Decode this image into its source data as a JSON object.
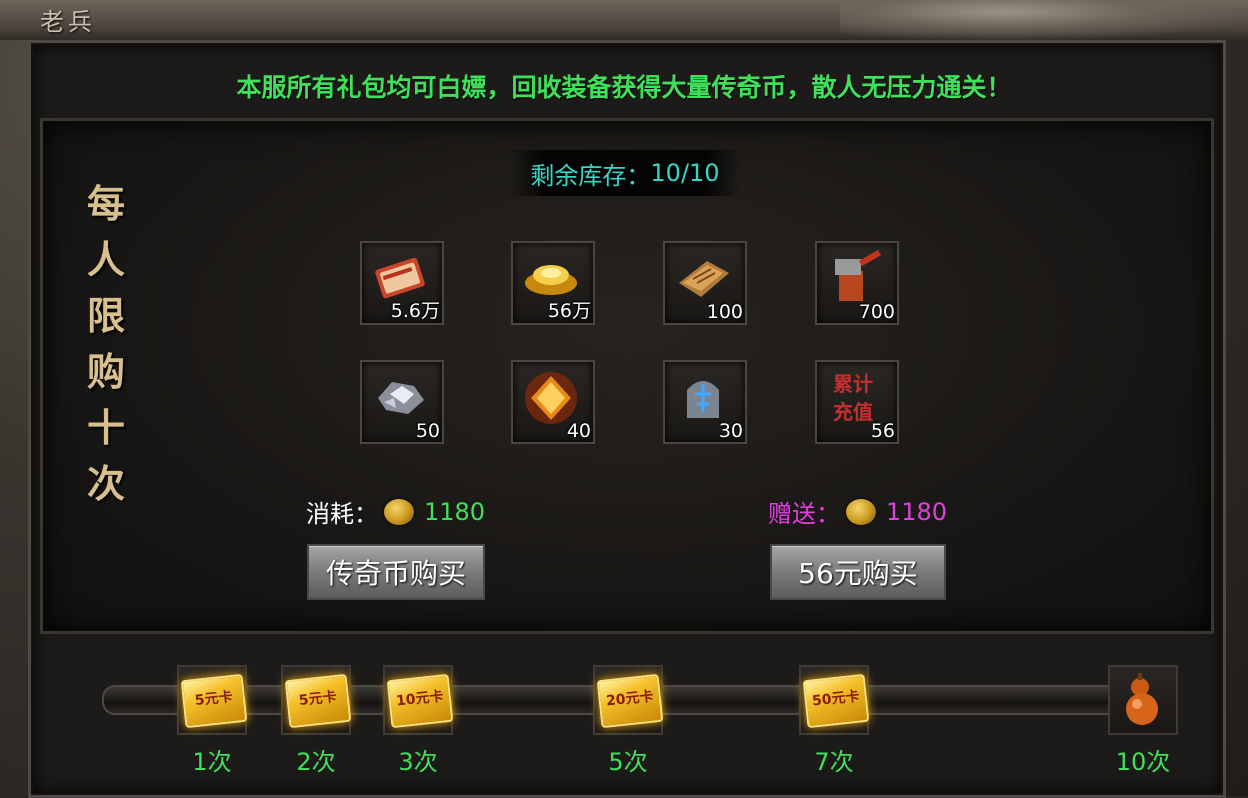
{
  "window": {
    "title": "老兵"
  },
  "banner": "本服所有礼包均可白嫖，回收装备获得大量传奇币，散人无压力通关！",
  "vertical_title": [
    "每",
    "人",
    "限",
    "购",
    "十",
    "次"
  ],
  "stock": {
    "label": "剩余库存：",
    "value": "10/10"
  },
  "items": [
    {
      "icon": "red-certificate-icon",
      "qty": "5.6万"
    },
    {
      "icon": "gold-ingot-icon",
      "qty": "56万"
    },
    {
      "icon": "scroll-icon",
      "qty": "100"
    },
    {
      "icon": "hammer-icon",
      "qty": "700"
    },
    {
      "icon": "diamond-ore-icon",
      "qty": "50"
    },
    {
      "icon": "fire-crystal-icon",
      "qty": "40"
    },
    {
      "icon": "rune-stone-icon",
      "qty": "30"
    },
    {
      "icon": "recharge-token-icon",
      "icon_text": "累计充值",
      "qty": "56"
    }
  ],
  "cost": {
    "label": "消耗：",
    "value": "1180",
    "color": "#3fe05a"
  },
  "gift": {
    "label": "赠送：",
    "value": "1180",
    "color": "#e040e0"
  },
  "buttons": {
    "coin_buy": "传奇币购买",
    "money_buy": "56元购买"
  },
  "milestones": [
    {
      "label": "1次",
      "reward": "5元卡"
    },
    {
      "label": "2次",
      "reward": "5元卡"
    },
    {
      "label": "3次",
      "reward": "10元卡"
    },
    {
      "label": "5次",
      "reward": "20元卡"
    },
    {
      "label": "7次",
      "reward": "50元卡"
    },
    {
      "label": "10次",
      "reward": "gourd-icon"
    }
  ],
  "progress": {
    "current": 0,
    "max": 10
  },
  "colors": {
    "banner": "#3fe05a",
    "stock": "#39d6c8",
    "title": "#d8c08e"
  }
}
